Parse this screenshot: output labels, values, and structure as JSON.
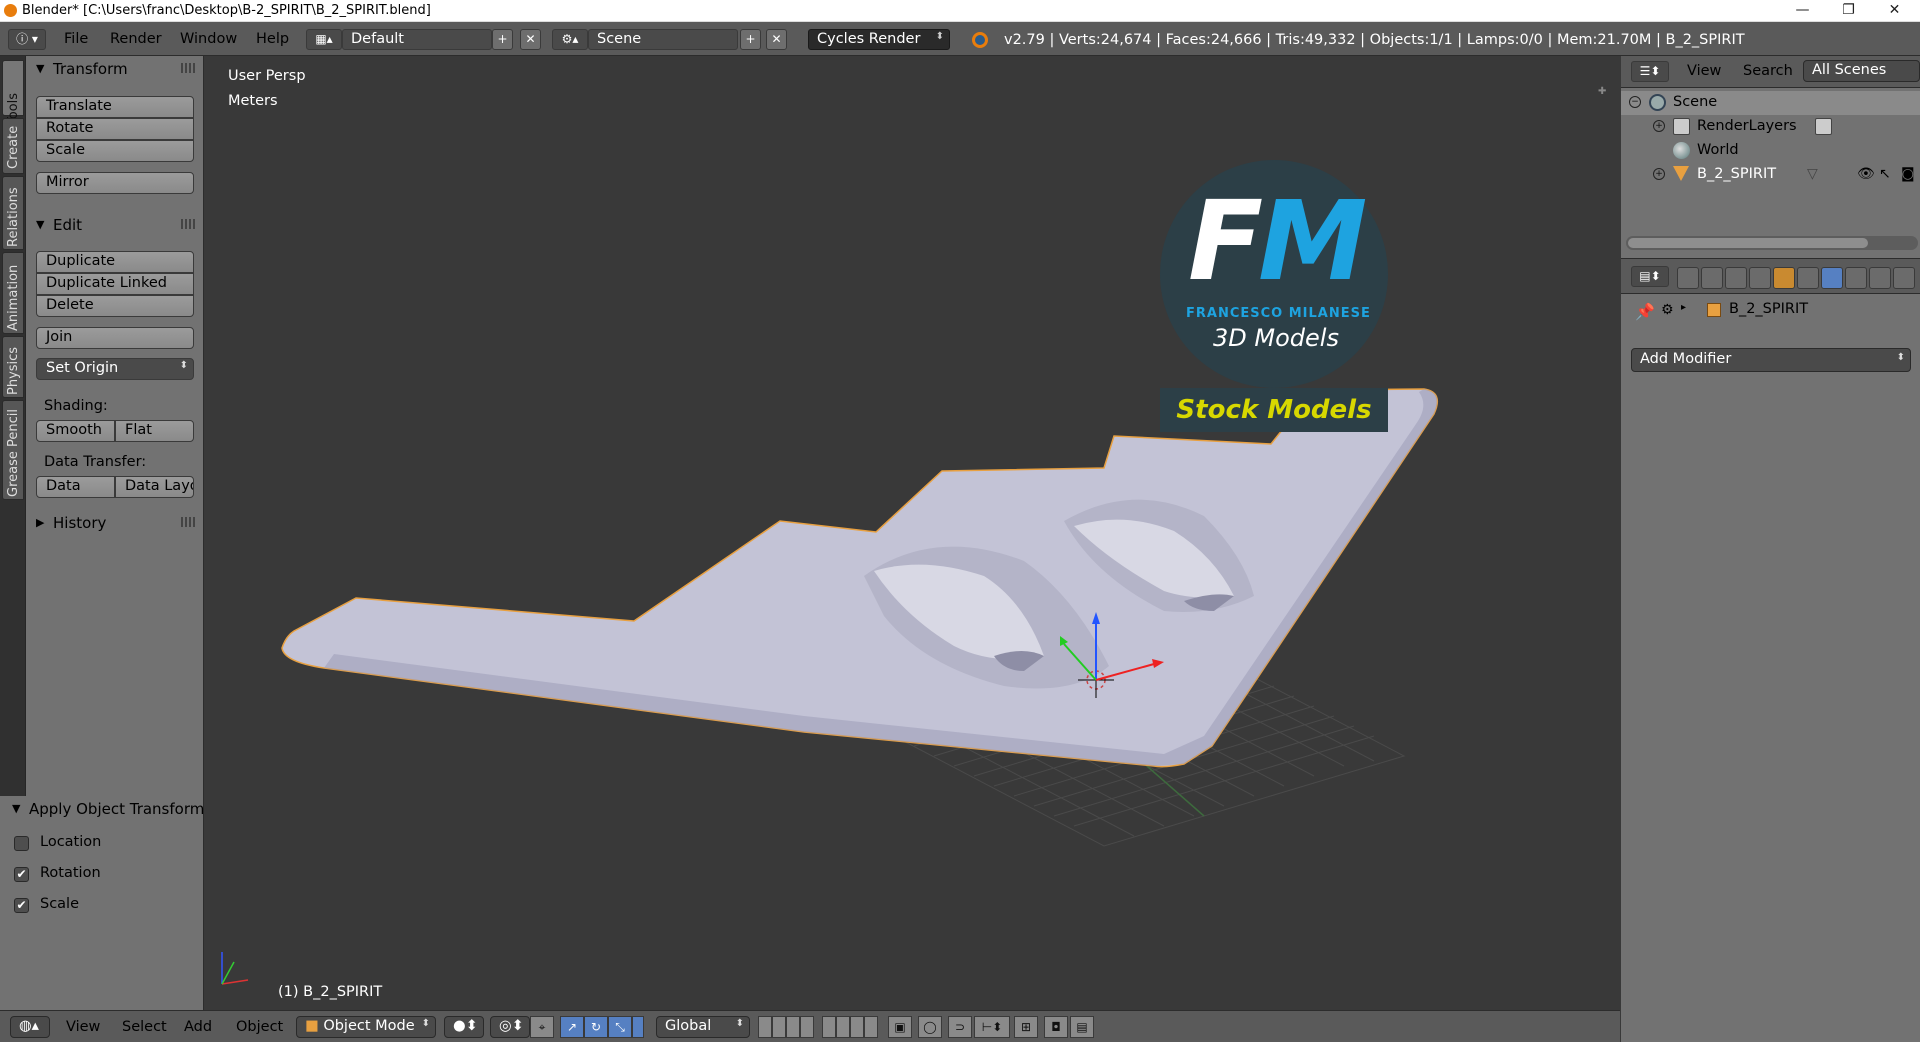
{
  "window": {
    "title": "Blender* [C:\\Users\\franc\\Desktop\\B-2_SPIRIT\\B_2_SPIRIT.blend]",
    "controls": {
      "minimize": "—",
      "restore": "❐",
      "close": "✕"
    }
  },
  "header": {
    "menus": [
      "File",
      "Render",
      "Window",
      "Help"
    ],
    "layout_name": "Default",
    "scene_name": "Scene",
    "render_engine": "Cycles Render",
    "stats": "v2.79 | Verts:24,674 | Faces:24,666 | Tris:49,332 | Objects:1/1 | Lamps:0/0 | Mem:21.70M | B_2_SPIRIT"
  },
  "left_tabs": [
    "Tools",
    "Create",
    "Relations",
    "Animation",
    "Physics",
    "Grease Pencil"
  ],
  "toolshelf": {
    "transform": {
      "title": "Transform",
      "buttons": [
        "Translate",
        "Rotate",
        "Scale"
      ],
      "mirror": "Mirror"
    },
    "edit": {
      "title": "Edit",
      "buttons": [
        "Duplicate",
        "Duplicate Linked",
        "Delete"
      ],
      "join": "Join",
      "set_origin": "Set Origin",
      "shading_label": "Shading:",
      "smooth": "Smooth",
      "flat": "Flat",
      "data_transfer_label": "Data Transfer:",
      "data": "Data",
      "data_layout": "Data Layo"
    },
    "history": {
      "title": "History"
    }
  },
  "operator_panel": {
    "title": "Apply Object Transform",
    "options": [
      {
        "label": "Location",
        "checked": false
      },
      {
        "label": "Rotation",
        "checked": true
      },
      {
        "label": "Scale",
        "checked": true
      }
    ]
  },
  "viewport": {
    "view_name": "User Persp",
    "units": "Meters",
    "object_label": "(1) B_2_SPIRIT",
    "logo": {
      "letters_f": "F",
      "letters_m": "M",
      "name": "FRANCESCO MILANESE",
      "subtitle": "3D Models",
      "banner": "Stock Models"
    }
  },
  "bottom_header": {
    "menus": [
      "View",
      "Select",
      "Add",
      "Object"
    ],
    "mode": "Object Mode",
    "orientation": "Global"
  },
  "outliner": {
    "header": {
      "view": "View",
      "search": "Search",
      "filter": "All Scenes"
    },
    "items": [
      {
        "label": "Scene",
        "level": 0
      },
      {
        "label": "RenderLayers",
        "level": 1
      },
      {
        "label": "World",
        "level": 1
      },
      {
        "label": "B_2_SPIRIT",
        "level": 1
      }
    ]
  },
  "properties": {
    "object_name": "B_2_SPIRIT",
    "add_modifier": "Add Modifier"
  },
  "colors": {
    "accent_blue": "#5680c2",
    "selection_orange": "#e8a040",
    "logo_blue": "#1ea3e0",
    "logo_yellow": "#d8d800"
  }
}
